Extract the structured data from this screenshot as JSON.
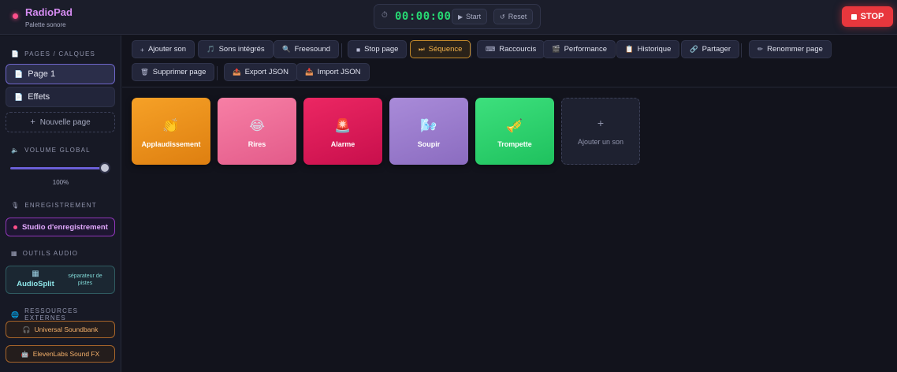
{
  "header": {
    "title": "RadioPad",
    "subtitle": "Palette sonore",
    "timer": "00:00:00",
    "start_label": "Start",
    "reset_label": "Reset",
    "stop_label": "STOP"
  },
  "sidebar": {
    "pages_title": "PAGES / CALQUES",
    "pages": [
      {
        "label": "Page 1",
        "active": true
      },
      {
        "label": "Effets",
        "active": false
      }
    ],
    "new_page_label": "Nouvelle page",
    "volume_title": "VOLUME GLOBAL",
    "volume": 100,
    "volume_display": "100%",
    "recording_title": "ENREGISTREMENT",
    "studio_label": "Studio d'enregistrement",
    "tools_title": "OUTILS AUDIO",
    "audiosplit_name": "AudioSplit",
    "audiosplit_desc": "séparateur de pistes",
    "resources_title": "RESSOURCES EXTERNES",
    "resources": [
      {
        "label": "Universal Soundbank",
        "icon": "headphones-icon"
      },
      {
        "label": "ElevenLabs Sound FX",
        "icon": "robot-icon"
      }
    ]
  },
  "toolbar": {
    "add_sound": "Ajouter son",
    "builtin_sounds": "Sons intégrés",
    "freesound": "Freesound",
    "stop_page": "Stop page",
    "sequence": "Séquence",
    "shortcuts": "Raccourcis",
    "performance": "Performance",
    "history": "Historique",
    "share": "Partager",
    "rename_page": "Renommer page",
    "delete_page": "Supprimer page",
    "export_json": "Export JSON",
    "import_json": "Import JSON"
  },
  "pads": [
    {
      "label": "Applaudissement",
      "emoji": "👏",
      "color": "#f39a1c"
    },
    {
      "label": "Rires",
      "emoji": "😂",
      "color": "#f0709a"
    },
    {
      "label": "Alarme",
      "emoji": "🚨",
      "color": "#e3185a"
    },
    {
      "label": "Soupir",
      "emoji": "🌬️",
      "color": "#9d7fd0"
    },
    {
      "label": "Trompette",
      "emoji": "🎺",
      "color": "#2ed46f"
    }
  ],
  "add_pad_label": "Ajouter un son",
  "colors": {
    "accent": "#6a5fd6",
    "stop": "#e8373d",
    "timer": "#27d873",
    "sequence": "#f2b24a"
  }
}
